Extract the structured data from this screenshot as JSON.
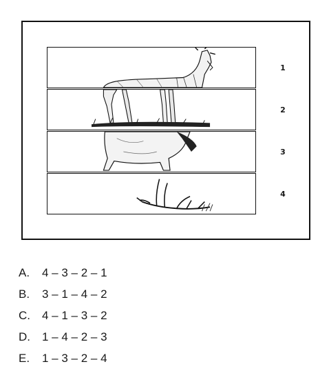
{
  "strips": [
    {
      "number": "1",
      "content": "elk-head-and-back"
    },
    {
      "number": "2",
      "content": "elk-legs-and-grass"
    },
    {
      "number": "3",
      "content": "elk-body-front"
    },
    {
      "number": "4",
      "content": "elk-antlers-on-ground"
    }
  ],
  "options": [
    {
      "letter": "A.",
      "text": "4 – 3 – 2 – 1"
    },
    {
      "letter": "B.",
      "text": "3 – 1 – 4 – 2"
    },
    {
      "letter": "C.",
      "text": "4 – 1 – 3 – 2"
    },
    {
      "letter": "D.",
      "text": "1 – 4 – 2 – 3"
    },
    {
      "letter": "E.",
      "text": "1 – 3 – 2 – 4"
    }
  ]
}
